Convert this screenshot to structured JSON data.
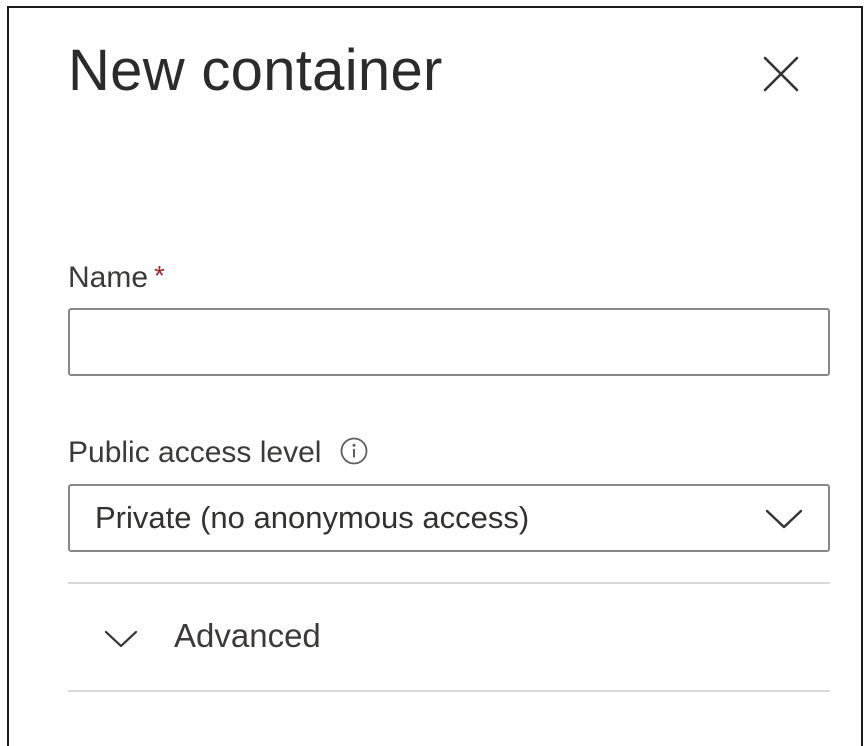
{
  "panel": {
    "title": "New container",
    "close_icon": "close-icon"
  },
  "form": {
    "name": {
      "label": "Name",
      "required_marker": "*",
      "value": "",
      "placeholder": ""
    },
    "public_access": {
      "label": "Public access level",
      "info_icon": "info-icon",
      "selected_value": "Private (no anonymous access)",
      "chevron_icon": "chevron-down-icon"
    },
    "advanced": {
      "label": "Advanced",
      "chevron_icon": "chevron-down-icon",
      "expanded": false
    }
  },
  "colors": {
    "required": "#a4262c",
    "border": "#8a8886",
    "divider": "#d9d9d9",
    "text": "#323130",
    "panel_border": "#1b1b1b"
  }
}
